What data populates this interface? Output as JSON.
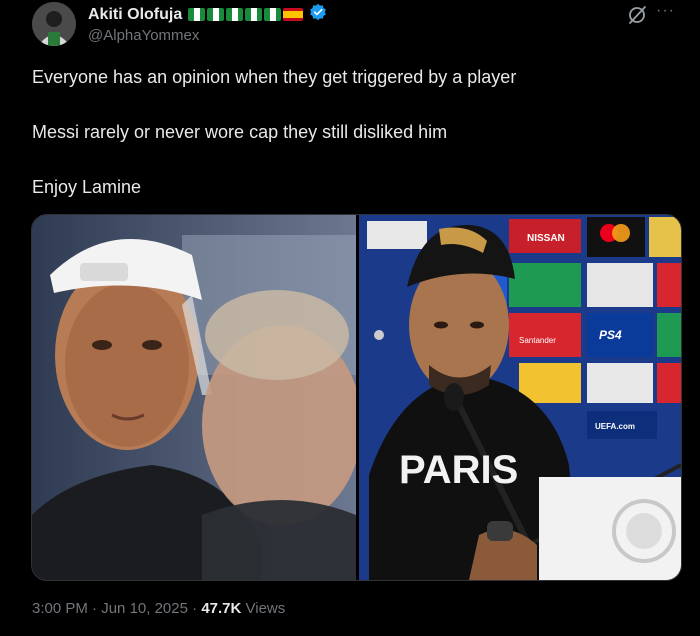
{
  "author": {
    "name": "Akiti Olofuja",
    "handle": "@AlphaYommex",
    "verified_color": "#1d9bf0"
  },
  "icons": [
    "grok-icon",
    "more-icon",
    "verified-badge-icon"
  ],
  "post": {
    "lines": [
      "Everyone has an opinion when they get triggered by a player",
      "Messi rarely or never wore cap they still disliked him",
      "Enjoy Lamine"
    ]
  },
  "media": {
    "left_photo": "man in white backwards cap beside blurred older man",
    "right_photo": "man in black cap at press conference, sponsor board behind",
    "jersey_text": "PARIS",
    "board_logos": [
      "NISSAN",
      "PS4",
      "Santander",
      "UEFA.com"
    ]
  },
  "footer": {
    "time": "3:00 PM",
    "date": "Jun 10, 2025",
    "views_count": "47.7K",
    "views_label": "Views",
    "sep": "·"
  }
}
